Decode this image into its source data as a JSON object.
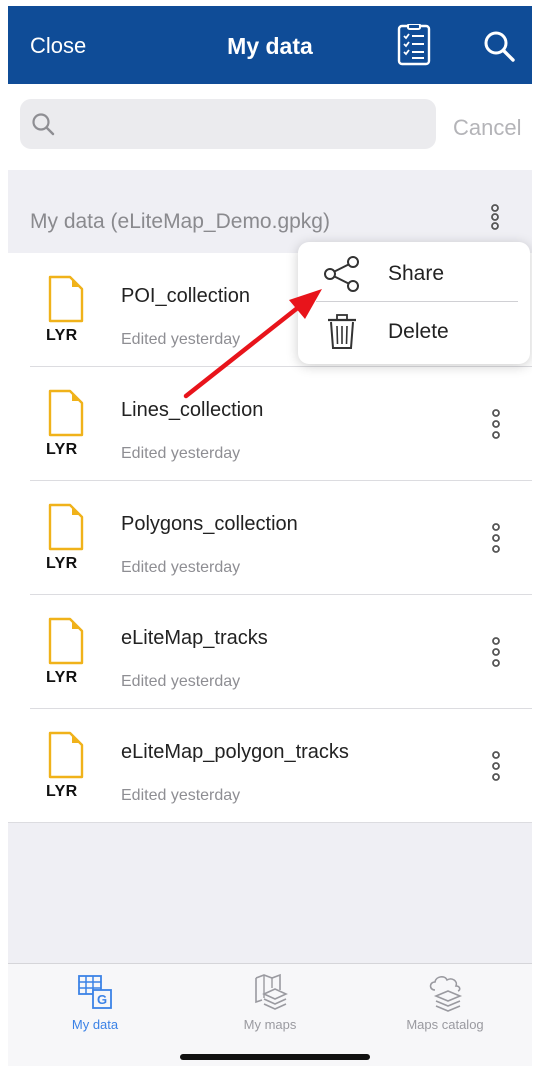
{
  "header": {
    "close_label": "Close",
    "title": "My data"
  },
  "search": {
    "placeholder": "",
    "value": "",
    "cancel_label": "Cancel"
  },
  "section": {
    "title": "My data (eLiteMap_Demo.gpkg)"
  },
  "files": [
    {
      "badge": "LYR",
      "name": "POI_collection",
      "subtitle": "Edited yesterday"
    },
    {
      "badge": "LYR",
      "name": "Lines_collection",
      "subtitle": "Edited yesterday"
    },
    {
      "badge": "LYR",
      "name": "Polygons_collection",
      "subtitle": "Edited yesterday"
    },
    {
      "badge": "LYR",
      "name": "eLiteMap_tracks",
      "subtitle": "Edited yesterday"
    },
    {
      "badge": "LYR",
      "name": "eLiteMap_polygon_tracks",
      "subtitle": "Edited yesterday"
    }
  ],
  "popup_menu": {
    "share_label": "Share",
    "delete_label": "Delete"
  },
  "tabbar": {
    "tabs": [
      {
        "label": "My data",
        "icon": "grid-g-icon",
        "active": true
      },
      {
        "label": "My maps",
        "icon": "map-layers-icon",
        "active": false
      },
      {
        "label": "Maps catalog",
        "icon": "cloud-layers-icon",
        "active": false
      }
    ]
  },
  "colors": {
    "header_bg": "#0f4c97",
    "accent": "#3b82e6",
    "file_icon": "#f0b21a",
    "annotation_arrow": "#e8141b"
  }
}
